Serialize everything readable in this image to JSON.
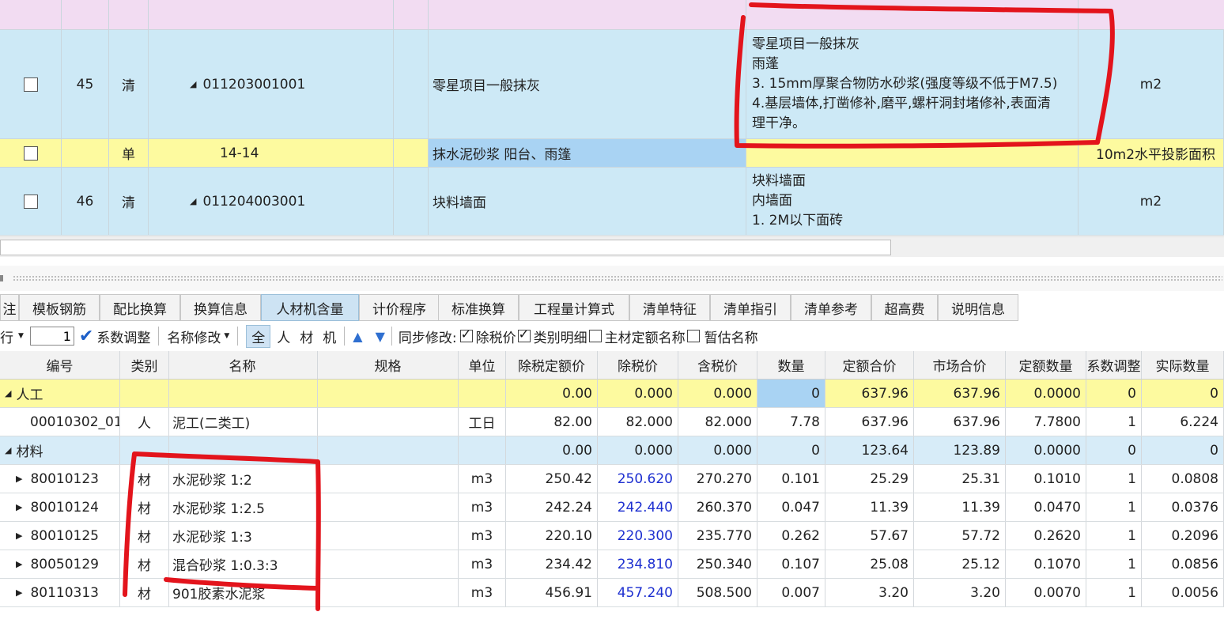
{
  "top_rows": [
    {
      "no": "45",
      "type": "清",
      "code": "011203001001",
      "name": "零星项目一般抹灰",
      "features": [
        "零星项目一般抹灰",
        "雨蓬",
        "3. 15mm厚聚合物防水砂浆(强度等级不低于M7.5)",
        "4.基层墙体,打凿修补,磨平,螺杆洞封堵修补,表面清",
        "理干净。"
      ],
      "unit": "m2"
    },
    {
      "no": "",
      "type": "单",
      "code": "14-14",
      "name": "抹水泥砂浆 阳台、雨篷",
      "features": [],
      "unit": "10m2水平投影面积"
    },
    {
      "no": "46",
      "type": "清",
      "code": "011204003001",
      "name": "块料墙面",
      "features": [
        "块料墙面",
        "内墙面",
        "1. 2M以下面砖"
      ],
      "unit": "m2"
    }
  ],
  "tabs": [
    "注",
    "模板钢筋",
    "配比换算",
    "换算信息",
    "人材机含量",
    "计价程序",
    "标准换算",
    "工程量计算式",
    "清单特征",
    "清单指引",
    "清单参考",
    "超高费",
    "说明信息"
  ],
  "active_tab": "人材机含量",
  "toolbar": {
    "row_label": "行",
    "row_value": "1",
    "coef_adjust": "系数调整",
    "name_modify": "名称修改",
    "filter_all": "全",
    "filter_labor": "人",
    "filter_material": "材",
    "filter_machine": "机",
    "sync_label": "同步修改:",
    "opt_tax_price": "除税价",
    "opt_category_detail": "类别明细",
    "opt_main_name": "主材定额名称",
    "opt_temp_name": "暂估名称"
  },
  "columns": [
    "编号",
    "类别",
    "名称",
    "规格",
    "单位",
    "除税定额价",
    "除税价",
    "含税价",
    "数量",
    "定额合价",
    "市场合价",
    "定额数量",
    "系数调整",
    "实际数量"
  ],
  "rows": [
    {
      "kind": "group-labor",
      "code": "人工",
      "cat": "",
      "name": "",
      "spec": "",
      "unit": "",
      "base": "0.00",
      "tax_ex": "0.000",
      "tax_in": "0.000",
      "qty": "0",
      "quota_total": "637.96",
      "market_total": "637.96",
      "quota_qty": "0.0000",
      "coef": "0",
      "actual": "0"
    },
    {
      "kind": "item",
      "code": "00010302_01",
      "cat": "人",
      "name": "泥工(二类工)",
      "spec": "",
      "unit": "工日",
      "base": "82.00",
      "tax_ex": "82.000",
      "tax_in": "82.000",
      "qty": "7.78",
      "quota_total": "637.96",
      "market_total": "637.96",
      "quota_qty": "7.7800",
      "coef": "1",
      "actual": "6.224"
    },
    {
      "kind": "group-material",
      "code": "材料",
      "cat": "",
      "name": "",
      "spec": "",
      "unit": "",
      "base": "0.00",
      "tax_ex": "0.000",
      "tax_in": "0.000",
      "qty": "0",
      "quota_total": "123.64",
      "market_total": "123.89",
      "quota_qty": "0.0000",
      "coef": "0",
      "actual": "0"
    },
    {
      "kind": "material",
      "code": "80010123",
      "cat": "材",
      "name": "水泥砂浆 1:2",
      "spec": "",
      "unit": "m3",
      "base": "250.42",
      "tax_ex": "250.620",
      "tax_in": "270.270",
      "qty": "0.101",
      "quota_total": "25.29",
      "market_total": "25.31",
      "quota_qty": "0.1010",
      "coef": "1",
      "actual": "0.0808"
    },
    {
      "kind": "material",
      "code": "80010124",
      "cat": "材",
      "name": "水泥砂浆 1:2.5",
      "spec": "",
      "unit": "m3",
      "base": "242.24",
      "tax_ex": "242.440",
      "tax_in": "260.370",
      "qty": "0.047",
      "quota_total": "11.39",
      "market_total": "11.39",
      "quota_qty": "0.0470",
      "coef": "1",
      "actual": "0.0376"
    },
    {
      "kind": "material",
      "code": "80010125",
      "cat": "材",
      "name": "水泥砂浆 1:3",
      "spec": "",
      "unit": "m3",
      "base": "220.10",
      "tax_ex": "220.300",
      "tax_in": "235.770",
      "qty": "0.262",
      "quota_total": "57.67",
      "market_total": "57.72",
      "quota_qty": "0.2620",
      "coef": "1",
      "actual": "0.2096"
    },
    {
      "kind": "material",
      "code": "80050129",
      "cat": "材",
      "name": "混合砂浆 1:0.3:3",
      "spec": "",
      "unit": "m3",
      "base": "234.42",
      "tax_ex": "234.810",
      "tax_in": "250.340",
      "qty": "0.107",
      "quota_total": "25.08",
      "market_total": "25.12",
      "quota_qty": "0.1070",
      "coef": "1",
      "actual": "0.0856"
    },
    {
      "kind": "material",
      "code": "80110313",
      "cat": "材",
      "name": "901胶素水泥浆",
      "spec": "",
      "unit": "m3",
      "base": "456.91",
      "tax_ex": "457.240",
      "tax_in": "508.500",
      "qty": "0.007",
      "quota_total": "3.20",
      "market_total": "3.20",
      "quota_qty": "0.0070",
      "coef": "1",
      "actual": "0.0056"
    }
  ],
  "colors": {
    "list_row_bg": "#cde9f6",
    "subitem_row_bg": "#fdfa9f",
    "selected_cell_bg": "#a9d3f3",
    "annotation_red": "#e3141c",
    "price_blue": "#1d2fd0"
  }
}
